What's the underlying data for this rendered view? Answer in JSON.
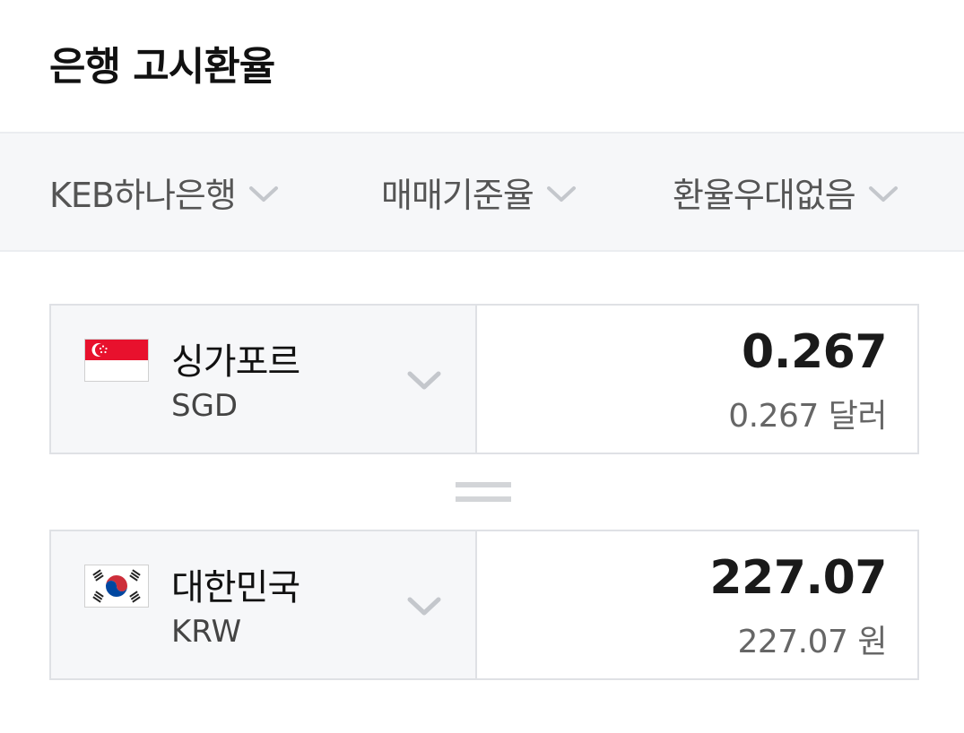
{
  "header": {
    "title": "은행 고시환율"
  },
  "filters": [
    {
      "label": "KEB하나은행"
    },
    {
      "label": "매매기준율"
    },
    {
      "label": "환율우대없음"
    }
  ],
  "from": {
    "country": "싱가포르",
    "code": "SGD",
    "amount": "0.267",
    "amount_text": "0.267 달러",
    "flag_icon": "singapore-flag-icon"
  },
  "to": {
    "country": "대한민국",
    "code": "KRW",
    "amount": "227.07",
    "amount_text": "227.07 원",
    "flag_icon": "south-korea-flag-icon"
  },
  "colors": {
    "filter_bg": "#f6f7f9",
    "border": "#dfe1e5",
    "chevron": "#c4c7cc"
  }
}
